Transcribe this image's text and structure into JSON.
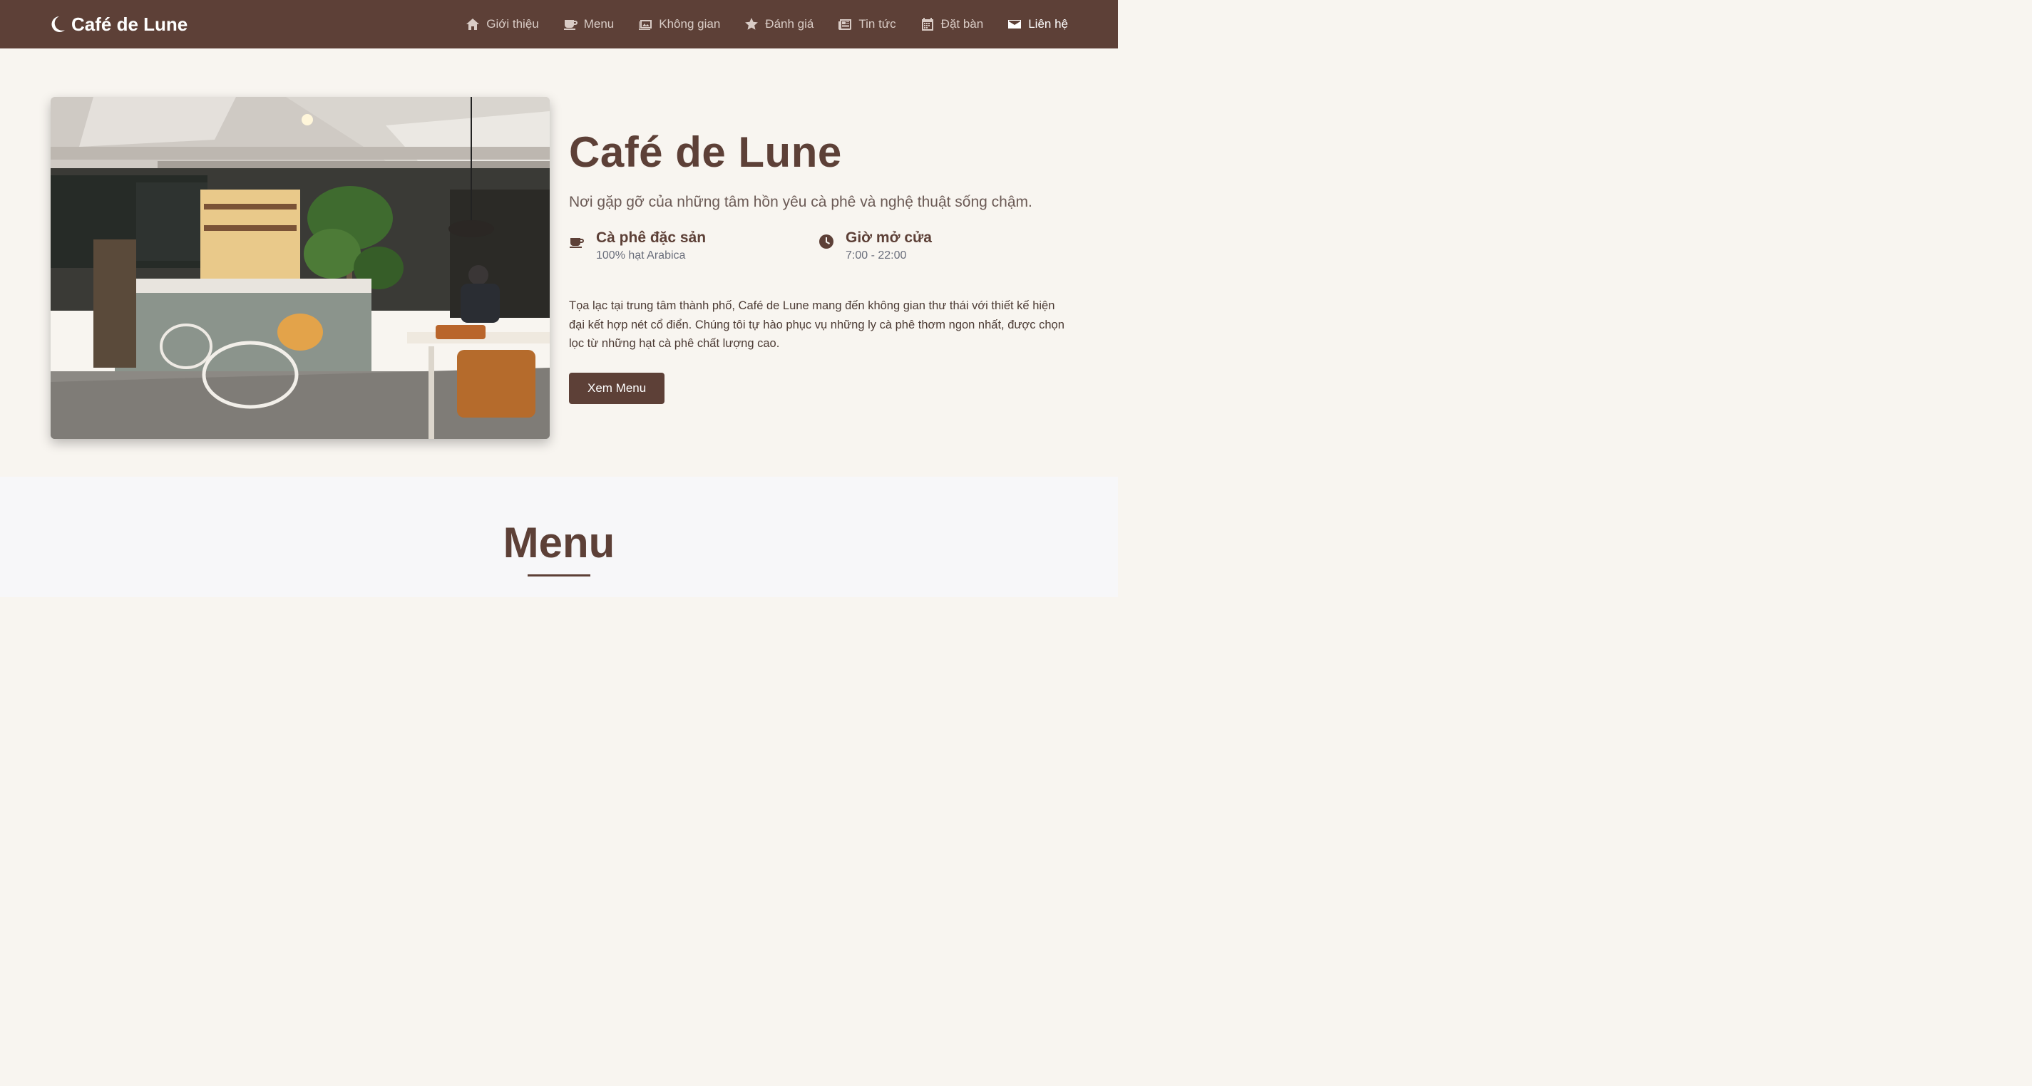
{
  "brand": {
    "name": "Café de Lune",
    "icon": "moon-icon"
  },
  "nav": {
    "items": [
      {
        "label": "Giới thiệu",
        "icon": "home-icon"
      },
      {
        "label": "Menu",
        "icon": "coffee-icon"
      },
      {
        "label": "Không gian",
        "icon": "image-icon"
      },
      {
        "label": "Đánh giá",
        "icon": "star-icon"
      },
      {
        "label": "Tin tức",
        "icon": "newspaper-icon"
      },
      {
        "label": "Đặt bàn",
        "icon": "calendar-icon"
      },
      {
        "label": "Liên hệ",
        "icon": "envelope-icon"
      }
    ],
    "active_index": 6
  },
  "hero": {
    "title": "Café de Lune",
    "subtitle": "Nơi gặp gỡ của những tâm hồn yêu cà phê và nghệ thuật sống chậm.",
    "features": [
      {
        "title": "Cà phê đặc sản",
        "sub": "100% hạt Arabica",
        "icon": "coffee-icon"
      },
      {
        "title": "Giờ mở cửa",
        "sub": "7:00 - 22:00",
        "icon": "clock-icon"
      }
    ],
    "description": "Tọa lạc tại trung tâm thành phố, Café de Lune mang đến không gian thư thái với thiết kế hiện đại kết hợp nét cổ điển. Chúng tôi tự hào phục vụ những ly cà phê thơm ngon nhất, được chọn lọc từ những hạt cà phê chất lượng cao.",
    "button_label": "Xem Menu"
  },
  "menu_section": {
    "title": "Menu"
  },
  "colors": {
    "primary": "#5d4037",
    "background": "#f8f5f0",
    "section_bg": "#f7f7f9"
  }
}
